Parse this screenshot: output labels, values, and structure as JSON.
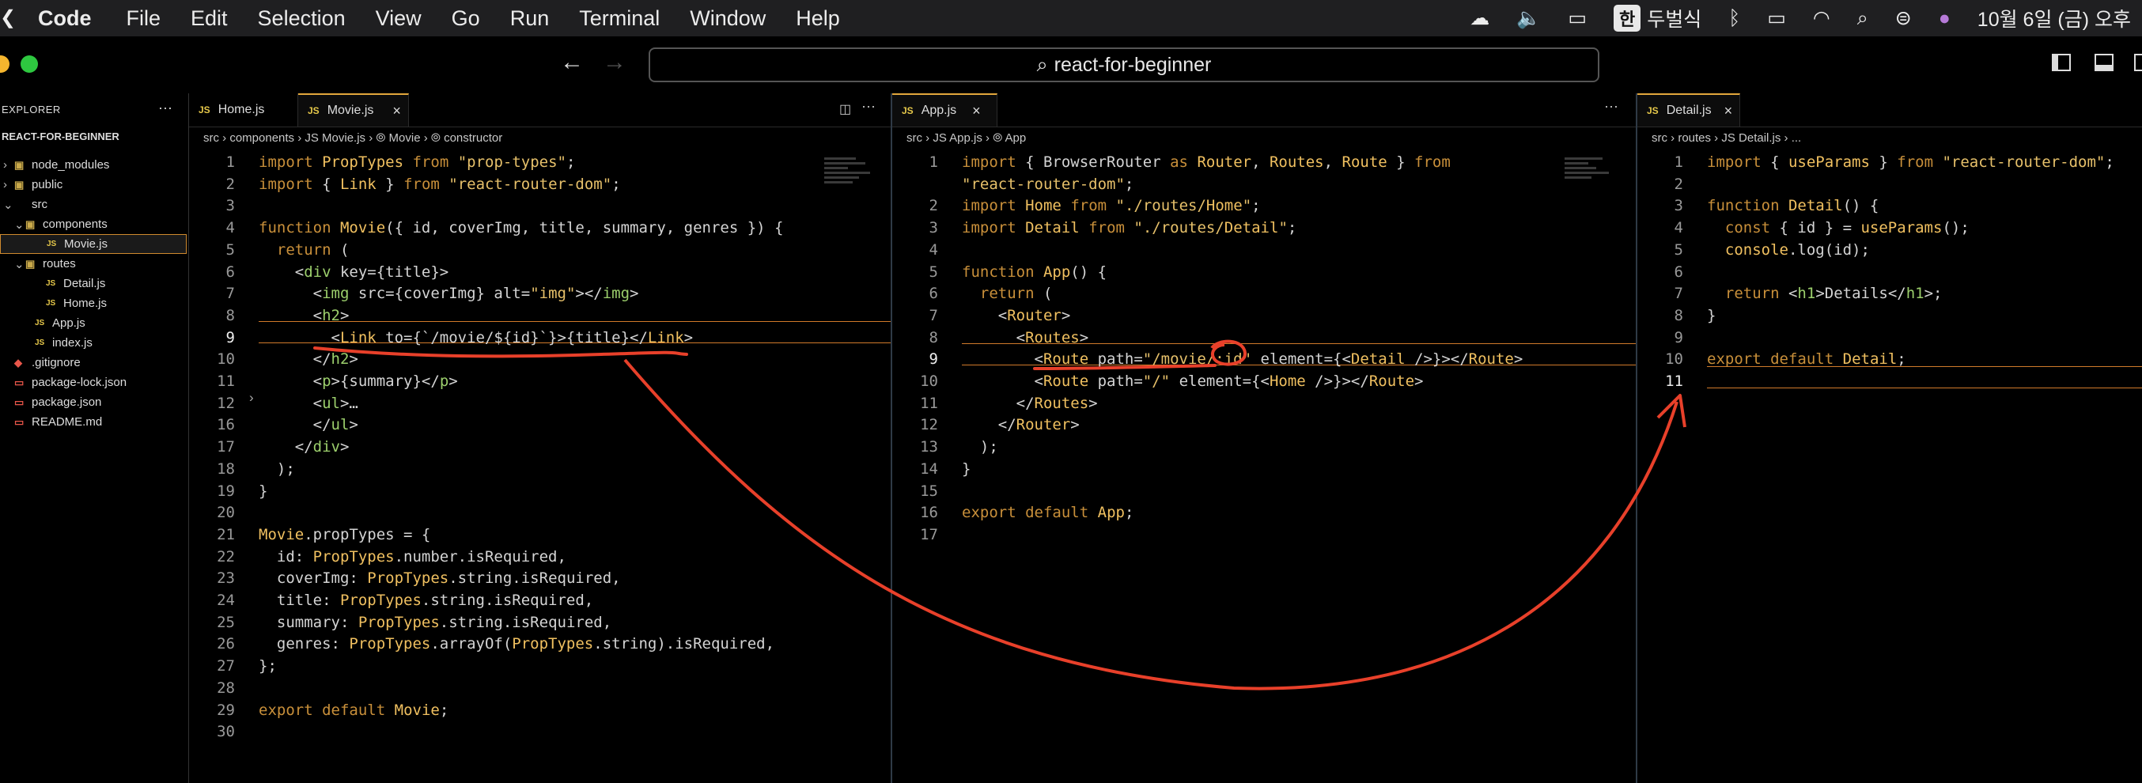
{
  "menubar": {
    "app": "Code",
    "items": [
      "File",
      "Edit",
      "Selection",
      "View",
      "Go",
      "Run",
      "Terminal",
      "Window",
      "Help"
    ],
    "input_source_badge": "한",
    "input_method": "두벌식",
    "clock": "10월 6일 (금) 오후"
  },
  "titlebar": {
    "search_text": "react-for-beginner"
  },
  "sidebar": {
    "header": "EXPLORER",
    "more": "···",
    "root": "REACT-FOR-BEGINNER",
    "items": [
      {
        "label": "node_modules",
        "chev": "›",
        "icon": "▣"
      },
      {
        "label": "public",
        "chev": "›",
        "icon": "▣"
      },
      {
        "label": "src",
        "chev": "⌄",
        "icon": ""
      },
      {
        "label": "components",
        "chev": "⌄",
        "icon": "▣"
      },
      {
        "label": "Movie.js",
        "chev": "",
        "icon": "JS"
      },
      {
        "label": "routes",
        "chev": "⌄",
        "icon": "▣"
      },
      {
        "label": "Detail.js",
        "chev": "",
        "icon": "JS"
      },
      {
        "label": "Home.js",
        "chev": "",
        "icon": "JS"
      },
      {
        "label": "App.js",
        "chev": "",
        "icon": "JS"
      },
      {
        "label": "index.js",
        "chev": "",
        "icon": "JS"
      },
      {
        "label": ".gitignore",
        "chev": "",
        "icon": "◆"
      },
      {
        "label": "package-lock.json",
        "chev": "",
        "icon": "▭"
      },
      {
        "label": "package.json",
        "chev": "",
        "icon": "▭"
      },
      {
        "label": "README.md",
        "chev": "",
        "icon": "▭"
      }
    ]
  },
  "pane1": {
    "tabs": [
      {
        "label": "Home.js"
      },
      {
        "label": "Movie.js"
      }
    ],
    "breadcrumb": "src › components › JS Movie.js › ⦾ Movie › ⦾ constructor",
    "lines": [
      {
        "n": "1",
        "t": "import PropTypes from \"prop-types\";"
      },
      {
        "n": "2",
        "t": "import { Link } from \"react-router-dom\";"
      },
      {
        "n": "3",
        "t": ""
      },
      {
        "n": "4",
        "t": "function Movie({ id, coverImg, title, summary, genres }) {"
      },
      {
        "n": "5",
        "t": "  return ("
      },
      {
        "n": "6",
        "t": "    <div key={title}>"
      },
      {
        "n": "7",
        "t": "      <img src={coverImg} alt=\"img\"></img>"
      },
      {
        "n": "8",
        "t": "      <h2>"
      },
      {
        "n": "9",
        "t": "        <Link to={`/movie/${id}`}>{title}</Link>"
      },
      {
        "n": "10",
        "t": "      </h2>"
      },
      {
        "n": "11",
        "t": "      <p>{summary}</p>"
      },
      {
        "n": "12",
        "t": "      <ul>…"
      },
      {
        "n": "16",
        "t": "      </ul>"
      },
      {
        "n": "17",
        "t": "    </div>"
      },
      {
        "n": "18",
        "t": "  );"
      },
      {
        "n": "19",
        "t": "}"
      },
      {
        "n": "20",
        "t": ""
      },
      {
        "n": "21",
        "t": "Movie.propTypes = {"
      },
      {
        "n": "22",
        "t": "  id: PropTypes.number.isRequired,"
      },
      {
        "n": "23",
        "t": "  coverImg: PropTypes.string.isRequired,"
      },
      {
        "n": "24",
        "t": "  title: PropTypes.string.isRequired,"
      },
      {
        "n": "25",
        "t": "  summary: PropTypes.string.isRequired,"
      },
      {
        "n": "26",
        "t": "  genres: PropTypes.arrayOf(PropTypes.string).isRequired,"
      },
      {
        "n": "27",
        "t": "};"
      },
      {
        "n": "28",
        "t": ""
      },
      {
        "n": "29",
        "t": "export default Movie;"
      },
      {
        "n": "30",
        "t": ""
      }
    ]
  },
  "pane2": {
    "tabs": [
      {
        "label": "App.js"
      }
    ],
    "breadcrumb": "src › JS App.js › ⦾ App",
    "lines": [
      {
        "n": "1",
        "t": "import { BrowserRouter as Router, Routes, Route } from"
      },
      {
        "n": "",
        "t": "\"react-router-dom\";"
      },
      {
        "n": "2",
        "t": "import Home from \"./routes/Home\";"
      },
      {
        "n": "3",
        "t": "import Detail from \"./routes/Detail\";"
      },
      {
        "n": "4",
        "t": ""
      },
      {
        "n": "5",
        "t": "function App() {"
      },
      {
        "n": "6",
        "t": "  return ("
      },
      {
        "n": "7",
        "t": "    <Router>"
      },
      {
        "n": "8",
        "t": "      <Routes>"
      },
      {
        "n": "9",
        "t": "        <Route path=\"/movie/:id\" element={<Detail />}></Route>"
      },
      {
        "n": "10",
        "t": "        <Route path=\"/\" element={<Home />}></Route>"
      },
      {
        "n": "11",
        "t": "      </Routes>"
      },
      {
        "n": "12",
        "t": "    </Router>"
      },
      {
        "n": "13",
        "t": "  );"
      },
      {
        "n": "14",
        "t": "}"
      },
      {
        "n": "15",
        "t": ""
      },
      {
        "n": "16",
        "t": "export default App;"
      },
      {
        "n": "17",
        "t": ""
      }
    ]
  },
  "pane3": {
    "tabs": [
      {
        "label": "Detail.js"
      }
    ],
    "breadcrumb": "src › routes › JS Detail.js › ...",
    "lines": [
      {
        "n": "1",
        "t": "import { useParams } from \"react-router-dom\";"
      },
      {
        "n": "2",
        "t": ""
      },
      {
        "n": "3",
        "t": "function Detail() {"
      },
      {
        "n": "4",
        "t": "  const { id } = useParams();"
      },
      {
        "n": "5",
        "t": "  console.log(id);"
      },
      {
        "n": "6",
        "t": ""
      },
      {
        "n": "7",
        "t": "  return <h1>Details</h1>;"
      },
      {
        "n": "8",
        "t": "}"
      },
      {
        "n": "9",
        "t": ""
      },
      {
        "n": "10",
        "t": "export default Detail;"
      },
      {
        "n": "11",
        "t": ""
      }
    ]
  },
  "colors": {
    "annotation": "#e8402a",
    "accent": "#e3a73c",
    "keyword": "#c88f3a"
  }
}
